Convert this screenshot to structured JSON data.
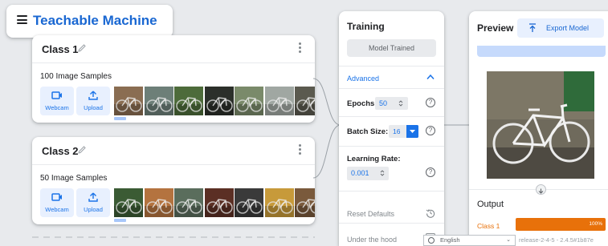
{
  "app": {
    "title": "Teachable Machine"
  },
  "classes": [
    {
      "name": "Class 1",
      "samples_label": "100 Image Samples",
      "webcam_label": "Webcam",
      "upload_label": "Upload",
      "thumb_colors": [
        "#8a6d52",
        "#6d7f78",
        "#4d6b3a",
        "#2b2f2a",
        "#7a8a6a",
        "#a0a7a2",
        "#5b5a4f"
      ]
    },
    {
      "name": "Class 2",
      "samples_label": "50 Image Samples",
      "webcam_label": "Webcam",
      "upload_label": "Upload",
      "thumb_colors": [
        "#3b5b34",
        "#b4733f",
        "#5a6d5c",
        "#5b2f24",
        "#3a3a3a",
        "#c79a3a",
        "#7a5a3c"
      ]
    }
  ],
  "training": {
    "title": "Training",
    "train_button": "Model Trained",
    "advanced_label": "Advanced",
    "epochs_label": "Epochs:",
    "epochs_value": "50",
    "batch_label": "Batch Size:",
    "batch_value": "16",
    "lr_label": "Learning Rate:",
    "lr_value": "0.001",
    "reset_label": "Reset Defaults",
    "hood_label": "Under the hood",
    "help_glyph": "?"
  },
  "preview": {
    "title": "Preview",
    "export_label": "Export Model",
    "output_label": "Output",
    "result_class": "Class 1",
    "result_percent_label": "100%",
    "result_fraction": 1.0
  },
  "footer": {
    "language": "English",
    "chevron": "⌄",
    "release": "release-2-4-5 - 2.4.5#1b87e"
  },
  "colors": {
    "accent": "#1a73e8",
    "brand": "#1967d2",
    "output": "#e8710a"
  },
  "icons": [
    "menu-icon",
    "pencil-icon",
    "more-vert-icon",
    "webcam-icon",
    "upload-icon",
    "chevron-up-icon",
    "help-icon",
    "reset-icon",
    "chart-icon",
    "export-icon",
    "arrow-down-icon",
    "globe-icon"
  ]
}
